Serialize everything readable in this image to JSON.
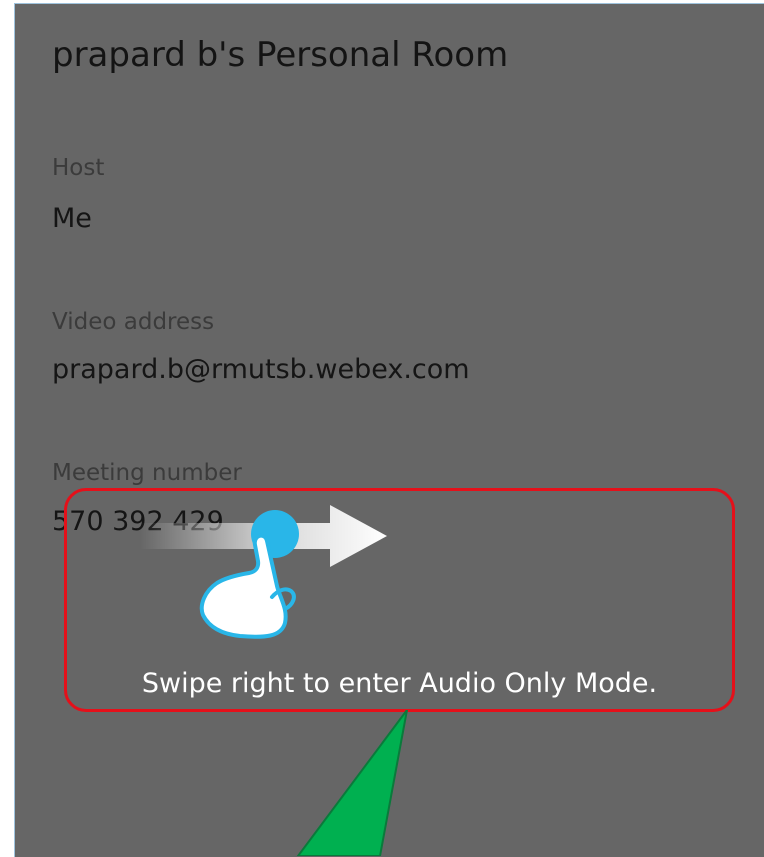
{
  "room": {
    "title": "prapard b's Personal Room"
  },
  "host": {
    "label": "Host",
    "value": "Me"
  },
  "video": {
    "label": "Video address",
    "value": "prapard.b@rmutsb.webex.com"
  },
  "meeting": {
    "label": "Meeting number",
    "value": "570 392 429"
  },
  "hint": {
    "text": "Swipe right to enter Audio Only Mode."
  },
  "icons": {
    "swipe": "swipe-right-hand-icon",
    "pointer": "green-pointer-arrow-icon"
  },
  "colors": {
    "overlay": "#666666",
    "highlight_border": "#e5101a",
    "touch_dot": "#29b6e8",
    "pointer": "#00b050"
  }
}
